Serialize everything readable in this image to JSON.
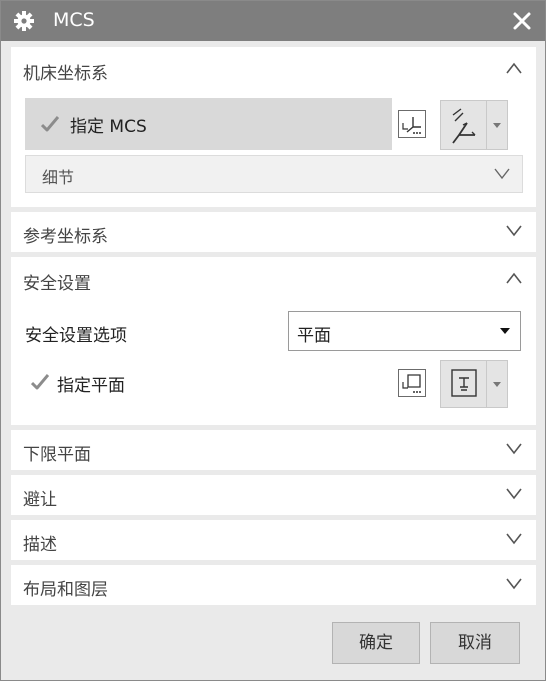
{
  "window": {
    "title": "MCS",
    "title_icon": "gear-icon",
    "close_icon": "close-icon"
  },
  "sections": {
    "machine_cs": {
      "title": "机床坐标系",
      "expanded": true,
      "specify_label": "指定 MCS",
      "detail_label": "细节",
      "detail_chevron": "V"
    },
    "reference_cs": {
      "title": "参考坐标系",
      "expanded": false
    },
    "safety": {
      "title": "安全设置",
      "expanded": true,
      "option_label": "安全设置选项",
      "option_value": "平面",
      "specify_plane_label": "指定平面"
    },
    "lower_plane": {
      "title": "下限平面",
      "expanded": false
    },
    "avoidance": {
      "title": "避让",
      "expanded": false
    },
    "description": {
      "title": "描述",
      "expanded": false
    },
    "layout_layers": {
      "title": "布局和图层",
      "expanded": false
    }
  },
  "buttons": {
    "ok": "确定",
    "cancel": "取消"
  },
  "colors": {
    "titlebar": "#7e7e7e",
    "dialog_bg": "#eaeaea",
    "panel_bg": "#ffffff",
    "selected_row": "#d9d9d9",
    "checkmark": "#8c8c8c"
  }
}
